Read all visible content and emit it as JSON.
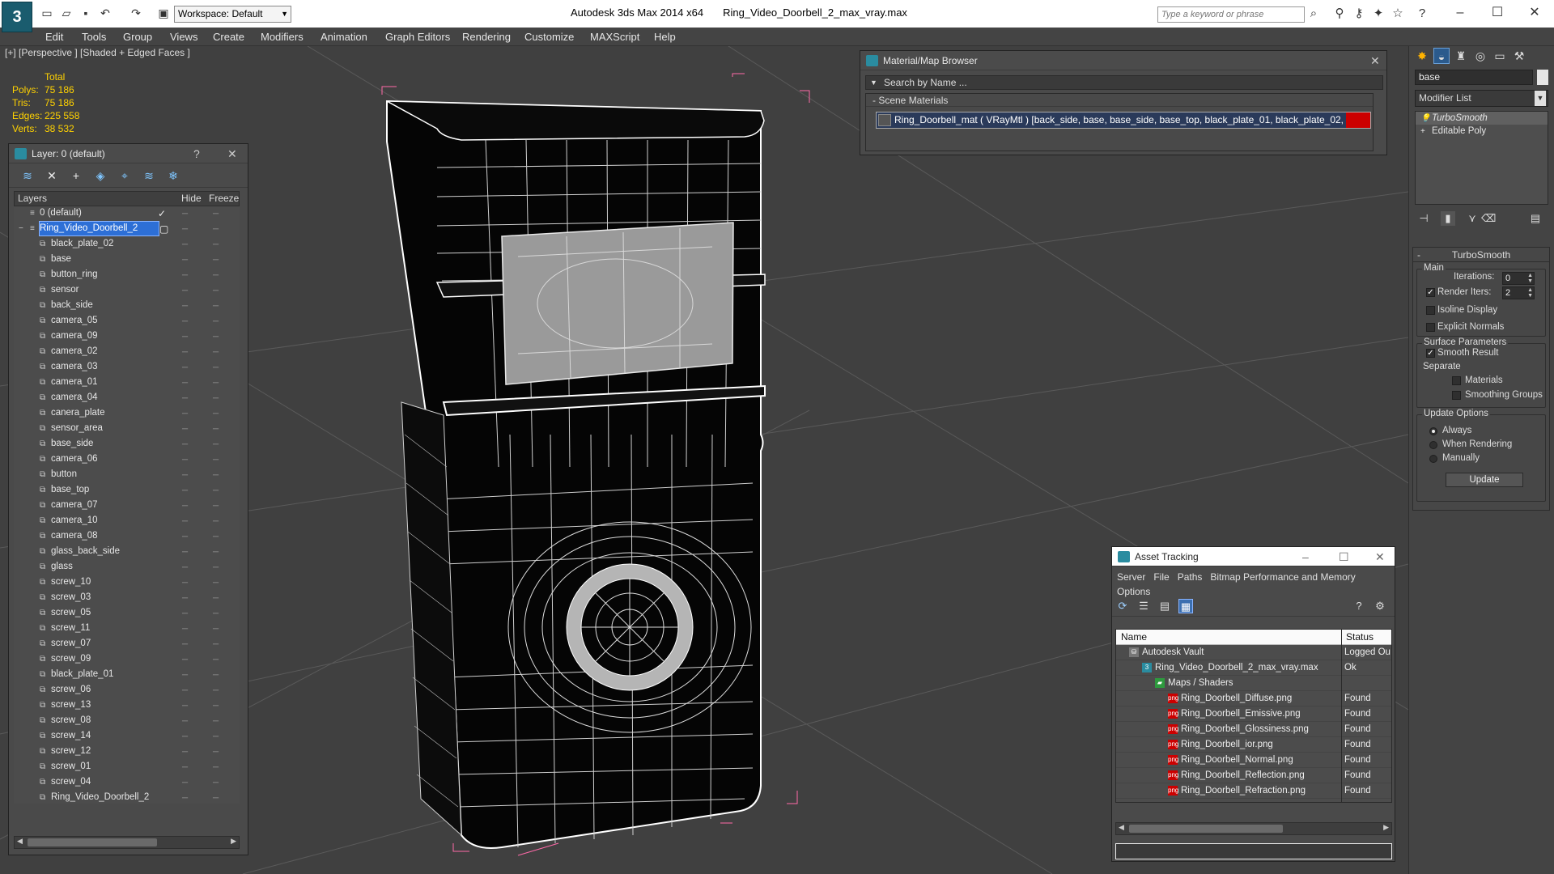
{
  "titlebar": {
    "workspace": "Workspace: Default",
    "app_name": "Autodesk 3ds Max  2014 x64",
    "file_name": "Ring_Video_Doorbell_2_max_vray.max",
    "search_placeholder": "Type a keyword or phrase"
  },
  "menu": [
    "Edit",
    "Tools",
    "Group",
    "Views",
    "Create",
    "Modifiers",
    "Animation",
    "Graph Editors",
    "Rendering",
    "Customize",
    "MAXScript",
    "Help"
  ],
  "viewport": {
    "label": "[+] [Perspective ] [Shaded + Edged Faces ]",
    "stats": {
      "total_label": "Total",
      "rows": [
        {
          "label": "Polys:",
          "value": "75 186"
        },
        {
          "label": "Tris:",
          "value": "75 186"
        },
        {
          "label": "Edges:",
          "value": "225 558"
        },
        {
          "label": "Verts:",
          "value": "38 532"
        }
      ]
    }
  },
  "layer_panel": {
    "title": "Layer: 0 (default)",
    "help": "?",
    "col_layers": "Layers",
    "col_hide": "Hide",
    "col_freeze": "Freeze",
    "layers": [
      {
        "name": "0 (default)",
        "level": 0,
        "check": "✓"
      },
      {
        "name": "Ring_Video_Doorbell_2",
        "level": 0,
        "selected": true
      },
      {
        "name": "black_plate_02",
        "level": 1
      },
      {
        "name": "base",
        "level": 1
      },
      {
        "name": "button_ring",
        "level": 1
      },
      {
        "name": "sensor",
        "level": 1
      },
      {
        "name": "back_side",
        "level": 1
      },
      {
        "name": "camera_05",
        "level": 1
      },
      {
        "name": "camera_09",
        "level": 1
      },
      {
        "name": "camera_02",
        "level": 1
      },
      {
        "name": "camera_03",
        "level": 1
      },
      {
        "name": "camera_01",
        "level": 1
      },
      {
        "name": "camera_04",
        "level": 1
      },
      {
        "name": "canera_plate",
        "level": 1
      },
      {
        "name": "sensor_area",
        "level": 1
      },
      {
        "name": "base_side",
        "level": 1
      },
      {
        "name": "camera_06",
        "level": 1
      },
      {
        "name": "button",
        "level": 1
      },
      {
        "name": "base_top",
        "level": 1
      },
      {
        "name": "camera_07",
        "level": 1
      },
      {
        "name": "camera_10",
        "level": 1
      },
      {
        "name": "camera_08",
        "level": 1
      },
      {
        "name": "glass_back_side",
        "level": 1
      },
      {
        "name": "glass",
        "level": 1
      },
      {
        "name": "screw_10",
        "level": 1
      },
      {
        "name": "screw_03",
        "level": 1
      },
      {
        "name": "screw_05",
        "level": 1
      },
      {
        "name": "screw_11",
        "level": 1
      },
      {
        "name": "screw_07",
        "level": 1
      },
      {
        "name": "screw_09",
        "level": 1
      },
      {
        "name": "black_plate_01",
        "level": 1
      },
      {
        "name": "screw_06",
        "level": 1
      },
      {
        "name": "screw_13",
        "level": 1
      },
      {
        "name": "screw_08",
        "level": 1
      },
      {
        "name": "screw_14",
        "level": 1
      },
      {
        "name": "screw_12",
        "level": 1
      },
      {
        "name": "screw_01",
        "level": 1
      },
      {
        "name": "screw_04",
        "level": 1
      },
      {
        "name": "Ring_Video_Doorbell_2",
        "level": 1
      }
    ]
  },
  "material_browser": {
    "title": "Material/Map Browser",
    "search": "Search by Name ...",
    "section": "- Scene Materials",
    "entry": "Ring_Doorbell_mat ( VRayMtl ) [back_side, base, base_side, base_top, black_plate_01, black_plate_02, button, bu..."
  },
  "asset_tracking": {
    "title": "Asset Tracking",
    "menu_row1": [
      "Server",
      "File",
      "Paths",
      "Bitmap Performance and Memory"
    ],
    "menu_row2": [
      "Options"
    ],
    "col_name": "Name",
    "col_status": "Status",
    "rows": [
      {
        "name": "Autodesk Vault",
        "status": "Logged Ou",
        "indent": 1,
        "icon": "vault-icon"
      },
      {
        "name": "Ring_Video_Doorbell_2_max_vray.max",
        "status": "Ok",
        "indent": 2,
        "icon": "max-file-icon"
      },
      {
        "name": "Maps / Shaders",
        "status": "",
        "indent": 3,
        "icon": "maps-folder-icon"
      },
      {
        "name": "Ring_Doorbell_Diffuse.png",
        "status": "Found",
        "indent": 4,
        "icon": "png-icon"
      },
      {
        "name": "Ring_Doorbell_Emissive.png",
        "status": "Found",
        "indent": 4,
        "icon": "png-icon"
      },
      {
        "name": "Ring_Doorbell_Glossiness.png",
        "status": "Found",
        "indent": 4,
        "icon": "png-icon"
      },
      {
        "name": "Ring_Doorbell_ior.png",
        "status": "Found",
        "indent": 4,
        "icon": "png-icon"
      },
      {
        "name": "Ring_Doorbell_Normal.png",
        "status": "Found",
        "indent": 4,
        "icon": "png-icon"
      },
      {
        "name": "Ring_Doorbell_Reflection.png",
        "status": "Found",
        "indent": 4,
        "icon": "png-icon"
      },
      {
        "name": "Ring_Doorbell_Refraction.png",
        "status": "Found",
        "indent": 4,
        "icon": "png-icon"
      }
    ]
  },
  "command_panel": {
    "object_name": "base",
    "modifier_list": "Modifier List",
    "stack": [
      "TurboSmooth",
      "Editable Poly"
    ],
    "rollout_title": "TurboSmooth",
    "main_label": "Main",
    "iterations_label": "Iterations:",
    "iterations_value": "0",
    "render_iters_label": "Render Iters:",
    "render_iters_value": "2",
    "isoline_label": "Isoline Display",
    "explicit_normals_label": "Explicit Normals",
    "surface_label": "Surface Parameters",
    "smooth_result_label": "Smooth Result",
    "separate_label": "Separate",
    "materials_label": "Materials",
    "smoothing_groups_label": "Smoothing Groups",
    "update_options_label": "Update Options",
    "always_label": "Always",
    "when_rendering_label": "When Rendering",
    "manually_label": "Manually",
    "update_button": "Update"
  },
  "colors": {
    "accent": "#2d6fd6",
    "stats_yellow": "#ffd200",
    "found_red": "#cc0000"
  }
}
